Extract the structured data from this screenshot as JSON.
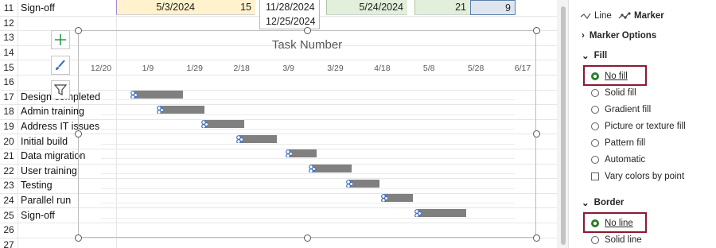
{
  "sheet": {
    "row_numbers": [
      "11",
      "12",
      "13",
      "14",
      "15",
      "16",
      "17",
      "18",
      "19",
      "20",
      "21",
      "22",
      "23",
      "24",
      "25",
      "26",
      "27"
    ],
    "task_names": [
      "Sign-off",
      "",
      "",
      "",
      "",
      "",
      "Design completed",
      "Admin training",
      "Address IT issues",
      "Initial build",
      "Data migration",
      "User training",
      "Testing",
      "Parallel run",
      "Sign-off",
      "",
      ""
    ],
    "row11": {
      "date1": "5/3/2024",
      "num1": "15",
      "date2": "5/24/2024",
      "num2": "21",
      "num3": "9"
    },
    "dropdown_dates": [
      "11/28/2024",
      "12/25/2024"
    ],
    "colors": {
      "yellow_fill": "#fff2cc",
      "green_fill": "#e2efda"
    }
  },
  "chart_data": {
    "type": "bar",
    "title": "Task Number",
    "x_tick_labels": [
      "12/20",
      "1/9",
      "1/29",
      "2/18",
      "3/9",
      "3/29",
      "4/18",
      "5/8",
      "5/28",
      "6/17"
    ],
    "categories": [
      "Design completed",
      "Admin training",
      "Address IT issues",
      "Initial build",
      "Data migration",
      "User training",
      "Testing",
      "Parallel run",
      "Sign-off"
    ],
    "series": [
      {
        "start": [
          "1/3",
          "1/14",
          "2/2",
          "2/17",
          "3/9",
          "3/19",
          "4/4",
          "4/19",
          "5/3"
        ],
        "duration_days": [
          21,
          19,
          17,
          16,
          12,
          17,
          13,
          12,
          21
        ]
      }
    ],
    "bar_color": "#808080",
    "xlim": [
      "12/20",
      "6/17"
    ],
    "grid": true
  },
  "chart_buttons": {
    "add_icon": "plus-icon",
    "style_icon": "brush-icon",
    "filter_icon": "funnel-icon"
  },
  "panel": {
    "tab_line": "Line",
    "tab_marker": "Marker",
    "marker_options": "Marker Options",
    "fill_section": "Fill",
    "fill_options": [
      "No fill",
      "Solid fill",
      "Gradient fill",
      "Picture or texture fill",
      "Pattern fill",
      "Automatic"
    ],
    "fill_selected": "No fill",
    "vary_colors": "Vary colors by point",
    "border_section": "Border",
    "border_options": [
      "No line",
      "Solid line"
    ],
    "border_selected": "No line",
    "colors": {
      "accent": "#2e7d32",
      "highlight": "#8b1a33"
    }
  }
}
